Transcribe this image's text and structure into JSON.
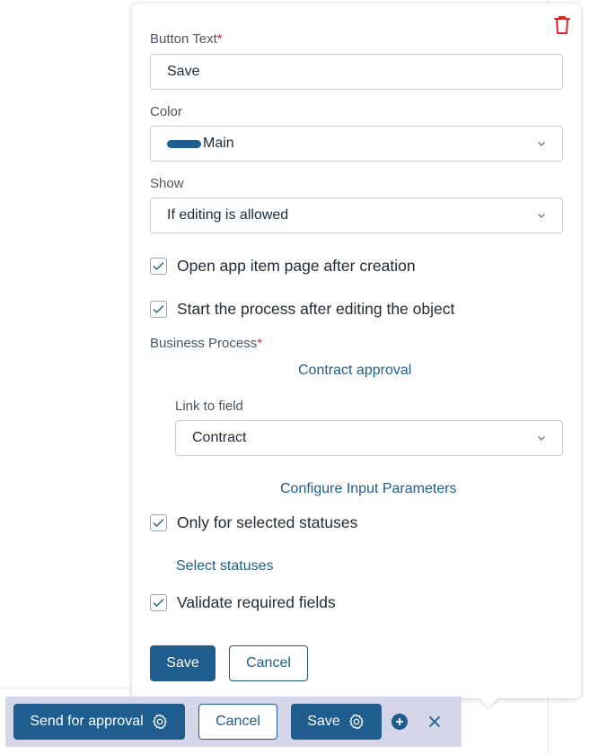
{
  "popover": {
    "button_text_label": "Button Text",
    "required_mark": "*",
    "button_text_value": "Save",
    "color_label": "Color",
    "color_value": "Main",
    "color_swatch": "#1e5d8d",
    "show_label": "Show",
    "show_value": "If editing is allowed",
    "open_page_checkbox": {
      "label": "Open app item page after creation",
      "checked": true
    },
    "start_process_checkbox": {
      "label": "Start the process after editing the object",
      "checked": true
    },
    "business_process_label": "Business Process",
    "business_process_link": "Contract approval",
    "link_to_field_label": "Link to field",
    "link_to_field_value": "Contract",
    "configure_link": "Configure Input Parameters",
    "selected_statuses_checkbox": {
      "label": "Only for selected statuses",
      "checked": true
    },
    "select_statuses_link": "Select statuses",
    "validate_checkbox": {
      "label": "Validate required fields",
      "checked": true
    },
    "save_button": "Save",
    "cancel_button": "Cancel"
  },
  "toolbar": {
    "send_for_approval": "Send for approval",
    "cancel": "Cancel",
    "save": "Save"
  },
  "colors": {
    "primary": "#1e5d8d",
    "danger": "#e02424",
    "toolbar_bg": "#d5d6e8"
  }
}
